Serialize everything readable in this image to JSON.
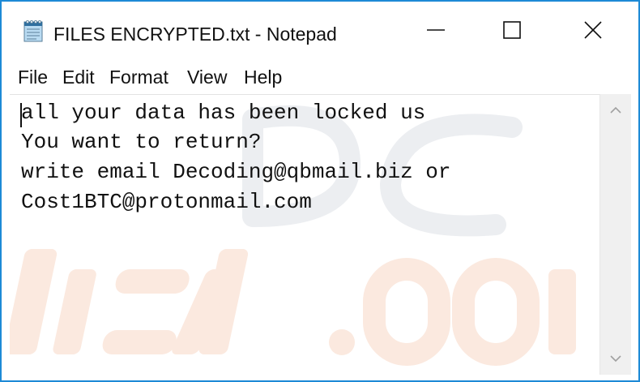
{
  "window": {
    "title": "FILES ENCRYPTED.txt - Notepad",
    "accent_color": "#1d8ad6",
    "app_icon": "notepad-icon"
  },
  "controls": {
    "minimize": "minimize-icon",
    "maximize": "maximize-icon",
    "close": "close-icon"
  },
  "menu": {
    "items": [
      "File",
      "Edit",
      "Format",
      "View",
      "Help"
    ]
  },
  "document": {
    "lines": [
      "all your data has been locked us",
      "You want to return?",
      "write email Decoding@qbmail.biz or",
      "Cost1BTC@protonmail.com"
    ]
  },
  "scrollbar": {
    "up": "chevron-up-icon",
    "down": "chevron-down-icon"
  }
}
